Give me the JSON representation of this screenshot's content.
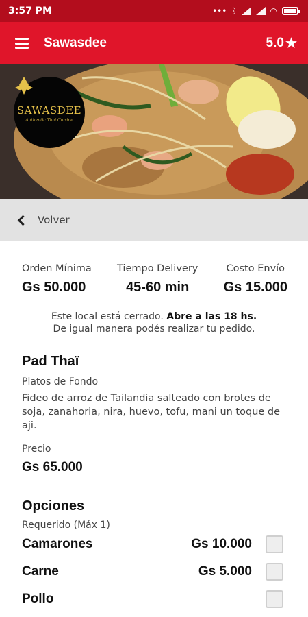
{
  "status_bar": {
    "time": "3:57 PM"
  },
  "header": {
    "title": "Sawasdee",
    "rating": "5.0",
    "star": "★"
  },
  "logo": {
    "name": "SAWASDEE",
    "tagline": "Authentic Thai Cuisine"
  },
  "back": {
    "label": "Volver"
  },
  "stats": [
    {
      "label": "Orden Mínima",
      "value": "Gs 50.000"
    },
    {
      "label": "Tiempo Delivery",
      "value": "45-60 min"
    },
    {
      "label": "Costo Envío",
      "value": "Gs 15.000"
    }
  ],
  "notice": {
    "line1_prefix": "Este local está cerrado.",
    "line1_bold": "Abre a las 18 hs.",
    "line2": "De igual manera podés realizar tu pedido."
  },
  "product": {
    "title": "Pad Thaï",
    "category": "Platos de Fondo",
    "description": "Fideo de arroz de Tailandia salteado con brotes de soja, zanahoria, nira, huevo, tofu, mani un toque de aji.",
    "price_label": "Precio",
    "price": "Gs 65.000"
  },
  "options": {
    "title": "Opciones",
    "requirement": "Requerido (Máx 1)",
    "items": [
      {
        "name": "Camarones",
        "price": "Gs 10.000"
      },
      {
        "name": "Carne",
        "price": "Gs 5.000"
      },
      {
        "name": "Pollo",
        "price": ""
      }
    ]
  },
  "colors": {
    "status_bar": "#b30d1d",
    "app_bar": "#e0152a",
    "back_bar": "#e2e2e2"
  },
  "icons": {
    "menu": "hamburger-menu-icon",
    "back": "chevron-left-icon",
    "rating": "star-icon"
  }
}
